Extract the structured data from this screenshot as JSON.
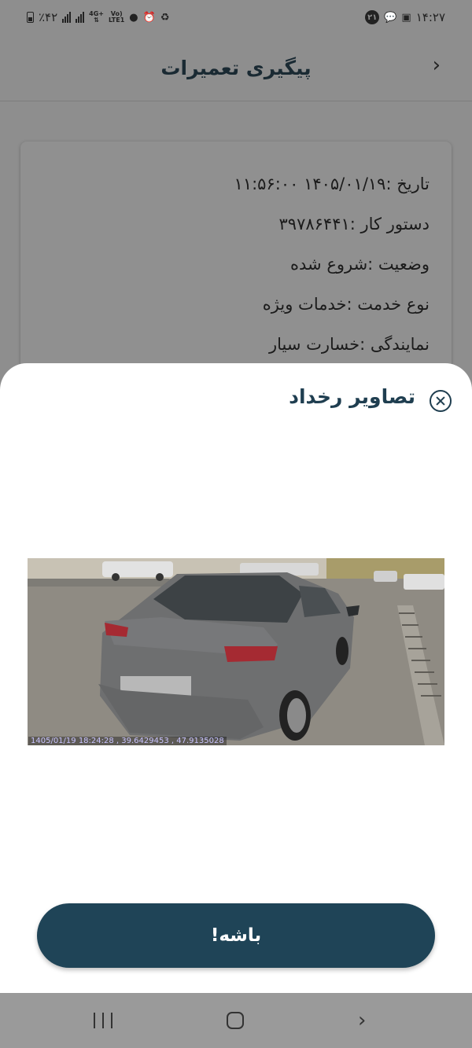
{
  "status_bar": {
    "battery": "٪۴۲",
    "network_tag_top": "4G+",
    "network_tag_bottom": "",
    "volte_top": "Vo)",
    "volte_bottom": "LTE1",
    "notification_count": "۲۱",
    "time": "۱۴:۲۷"
  },
  "header": {
    "title": "پیگیری تعمیرات",
    "back_icon": "chevron-right-icon"
  },
  "details": {
    "date": "تاریخ :۱۴۰۵/۰۱/۱۹ ۱۱:۵۶:۰۰",
    "work_order": "دستور کار :۳۹۷۸۶۴۴۱",
    "status": "وضعیت :شروع شده",
    "service_type": "نوع خدمت :خدمات ویژه",
    "agency": "نمایندگی :خسارت سیار"
  },
  "sheet": {
    "title": "تصاویر رخداد",
    "close_icon": "close-circle-icon",
    "photo_stamp": "1405/01/19 18:24:28 , 39.6429453 , 47.9135028",
    "ok_button": "باشه!"
  },
  "navigation": {
    "recents_icon": "recents-icon",
    "home_icon": "home-icon",
    "back_icon": "back-icon"
  },
  "colors": {
    "primary": "#1f4457",
    "title": "#1f3e50",
    "dim_overlay": "#8e8e8e"
  }
}
